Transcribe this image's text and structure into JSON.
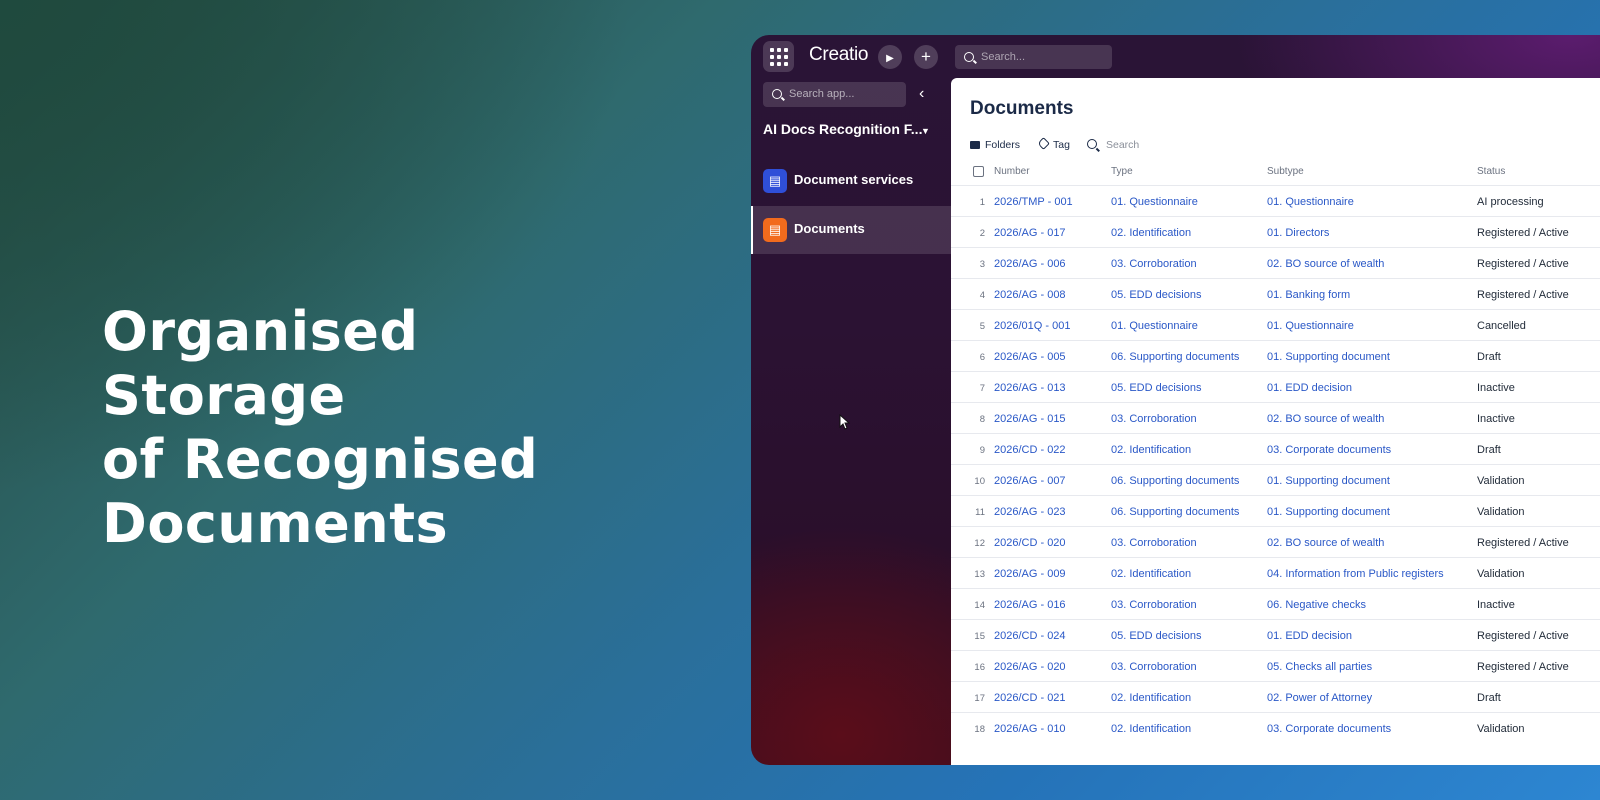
{
  "headline": [
    "Organised Storage",
    "of Recognised",
    "Documents"
  ],
  "topbar": {
    "logo": "Creatio",
    "run_icon": "▶",
    "add_icon": "+",
    "search_placeholder": "Search..."
  },
  "sidebar": {
    "search_placeholder": "Search app...",
    "collapse_icon": "‹",
    "app_title": "AI Docs Recognition F...",
    "items": [
      {
        "label": "Document services",
        "icon": "document-services-icon",
        "color": "#2f4fd8"
      },
      {
        "label": "Documents",
        "icon": "documents-icon",
        "color": "#f26b1d"
      }
    ]
  },
  "content": {
    "title": "Documents",
    "toolbar": {
      "folders": "Folders",
      "tag": "Tag",
      "search": "Search"
    },
    "columns": {
      "number": "Number",
      "type": "Type",
      "subtype": "Subtype",
      "status": "Status"
    },
    "rows": [
      {
        "idx": "1",
        "number": "2026/TMP - 001",
        "type": "01. Questionnaire",
        "subtype": "01. Questionnaire",
        "status": "AI processing"
      },
      {
        "idx": "2",
        "number": "2026/AG - 017",
        "type": "02. Identification",
        "subtype": "01. Directors",
        "status": "Registered / Active"
      },
      {
        "idx": "3",
        "number": "2026/AG - 006",
        "type": "03. Corroboration",
        "subtype": "02. BO source of wealth",
        "status": "Registered / Active"
      },
      {
        "idx": "4",
        "number": "2026/AG - 008",
        "type": "05. EDD decisions",
        "subtype": "01. Banking form",
        "status": "Registered / Active"
      },
      {
        "idx": "5",
        "number": "2026/01Q - 001",
        "type": "01. Questionnaire",
        "subtype": "01. Questionnaire",
        "status": "Cancelled"
      },
      {
        "idx": "6",
        "number": "2026/AG - 005",
        "type": "06. Supporting documents",
        "subtype": "01. Supporting document",
        "status": "Draft"
      },
      {
        "idx": "7",
        "number": "2026/AG - 013",
        "type": "05. EDD decisions",
        "subtype": "01. EDD decision",
        "status": "Inactive"
      },
      {
        "idx": "8",
        "number": "2026/AG - 015",
        "type": "03. Corroboration",
        "subtype": "02. BO source of wealth",
        "status": "Inactive"
      },
      {
        "idx": "9",
        "number": "2026/CD - 022",
        "type": "02. Identification",
        "subtype": "03. Corporate documents",
        "status": "Draft"
      },
      {
        "idx": "10",
        "number": "2026/AG - 007",
        "type": "06. Supporting documents",
        "subtype": "01. Supporting document",
        "status": "Validation"
      },
      {
        "idx": "11",
        "number": "2026/AG - 023",
        "type": "06. Supporting documents",
        "subtype": "01. Supporting document",
        "status": "Validation"
      },
      {
        "idx": "12",
        "number": "2026/CD - 020",
        "type": "03. Corroboration",
        "subtype": "02. BO source of wealth",
        "status": "Registered / Active"
      },
      {
        "idx": "13",
        "number": "2026/AG - 009",
        "type": "02. Identification",
        "subtype": "04. Information from Public registers",
        "status": "Validation"
      },
      {
        "idx": "14",
        "number": "2026/AG - 016",
        "type": "03. Corroboration",
        "subtype": "06. Negative checks",
        "status": "Inactive"
      },
      {
        "idx": "15",
        "number": "2026/CD - 024",
        "type": "05. EDD decisions",
        "subtype": "01. EDD decision",
        "status": "Registered / Active"
      },
      {
        "idx": "16",
        "number": "2026/AG - 020",
        "type": "03. Corroboration",
        "subtype": "05. Checks all parties",
        "status": "Registered / Active"
      },
      {
        "idx": "17",
        "number": "2026/CD - 021",
        "type": "02. Identification",
        "subtype": "02. Power of Attorney",
        "status": "Draft"
      },
      {
        "idx": "18",
        "number": "2026/AG - 010",
        "type": "02. Identification",
        "subtype": "03. Corporate documents",
        "status": "Validation"
      }
    ]
  }
}
